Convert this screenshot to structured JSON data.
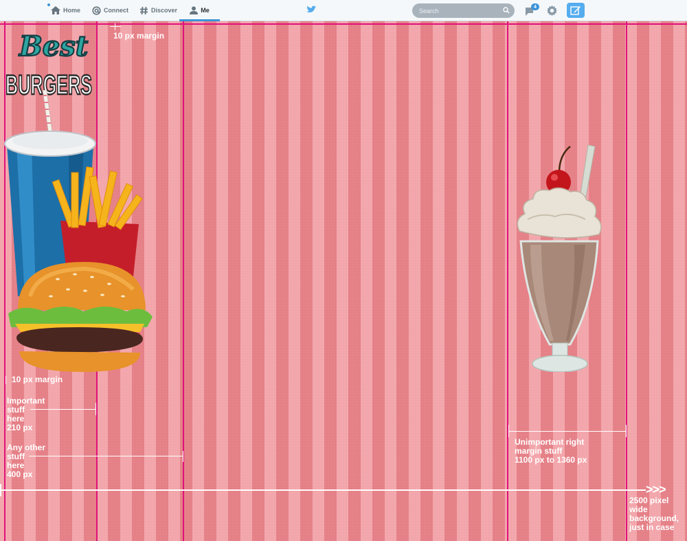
{
  "nav": {
    "home_label": "Home",
    "connect_label": "Connect",
    "discover_label": "Discover",
    "me_label": "Me",
    "search_placeholder": "Search",
    "messages_badge": "4",
    "accent_color": "#3b94d9"
  },
  "logo": {
    "script_text": "Best",
    "block_text": "BURGERS"
  },
  "annotations": {
    "top_margin": "10 px margin",
    "left_margin": "10 px margin",
    "important": [
      "Important",
      "stuff",
      "here",
      "210 px"
    ],
    "other": [
      "Any other",
      "stuff",
      "here",
      "400 px"
    ],
    "right_margin": [
      "Unimportant right",
      "margin stuff",
      "1100 px to 1360 px"
    ],
    "arrow_glyph": ">>>",
    "background_note": [
      "2500 pixel",
      "wide",
      "background,",
      "just in case"
    ]
  },
  "colors": {
    "stripe_light": "#f2a6ab",
    "stripe_dark": "#e58087",
    "guide_line": "#e0117a"
  }
}
